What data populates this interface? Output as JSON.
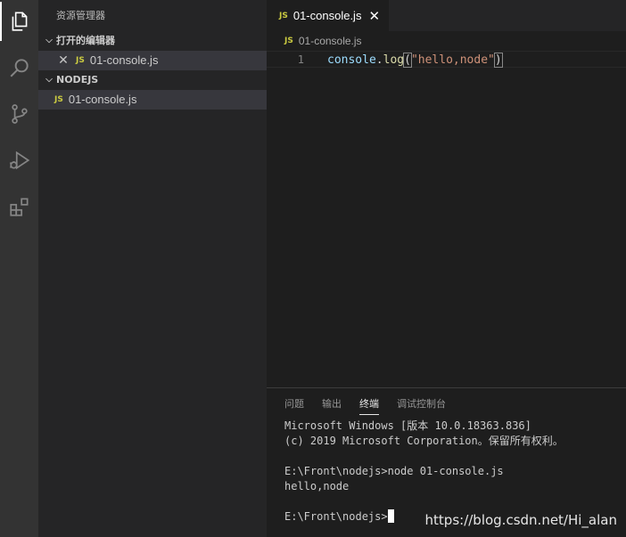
{
  "sidebar": {
    "title": "资源管理器",
    "open_editors": {
      "header": "打开的编辑器",
      "items": [
        {
          "badge": "JS",
          "label": "01-console.js"
        }
      ]
    },
    "folder": {
      "header": "NODEJS",
      "items": [
        {
          "badge": "JS",
          "label": "01-console.js"
        }
      ]
    }
  },
  "editor": {
    "tab": {
      "badge": "JS",
      "label": "01-console.js",
      "close": "✕"
    },
    "breadcrumb": {
      "badge": "JS",
      "label": "01-console.js"
    },
    "lines": [
      {
        "number": "1",
        "tokens": {
          "obj": "console",
          "dot": ".",
          "fn": "log",
          "open": "(",
          "str": "\"hello,node\"",
          "close": ")"
        }
      }
    ]
  },
  "panel": {
    "tabs": [
      "问题",
      "输出",
      "终端",
      "调试控制台"
    ],
    "active_tab": "终端",
    "terminal_lines": [
      "Microsoft Windows [版本 10.0.18363.836]",
      "(c) 2019 Microsoft Corporation。保留所有权利。",
      "",
      "E:\\Front\\nodejs>node 01-console.js",
      "hello,node",
      "",
      "E:\\Front\\nodejs>"
    ]
  },
  "watermark": "https://blog.csdn.net/Hi_alan",
  "colors": {
    "activity_bar": "#333333",
    "sidebar": "#252526",
    "editor": "#1e1e1e",
    "js_badge": "#cbcb41",
    "string": "#ce9178",
    "function": "#dcdcaa",
    "variable": "#9cdcfe"
  }
}
